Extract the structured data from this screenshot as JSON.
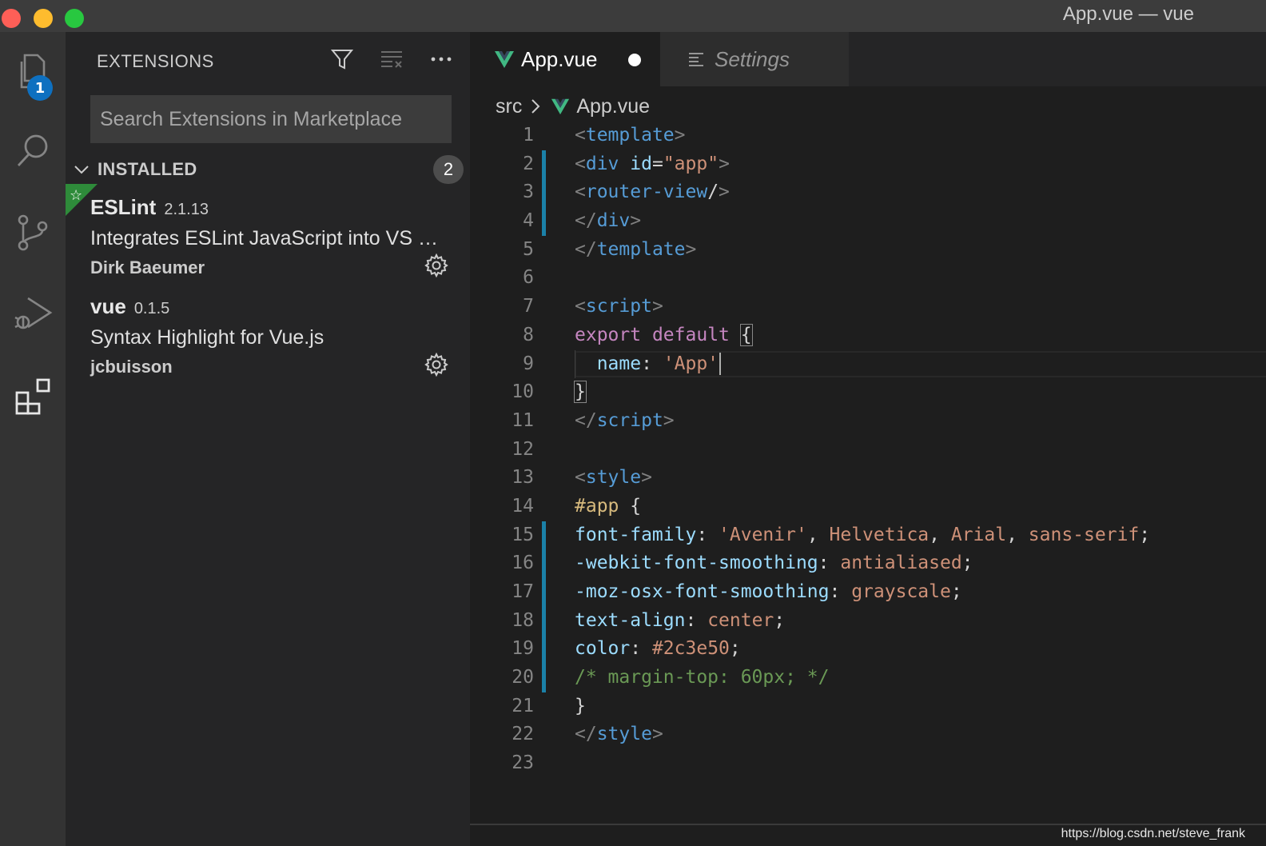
{
  "window": {
    "title": "App.vue — vue"
  },
  "activity_bar": {
    "items": [
      {
        "name": "explorer",
        "icon": "files-icon",
        "badge": "1"
      },
      {
        "name": "search",
        "icon": "search-icon"
      },
      {
        "name": "source-control",
        "icon": "source-control-icon"
      },
      {
        "name": "run-debug",
        "icon": "run-debug-icon"
      },
      {
        "name": "extensions",
        "icon": "extensions-icon",
        "active": true
      }
    ]
  },
  "sidebar": {
    "title": "EXTENSIONS",
    "actions": [
      "filter-icon",
      "clear-icon",
      "more-icon"
    ],
    "search": {
      "placeholder": "Search Extensions in Marketplace",
      "value": ""
    },
    "installed": {
      "label": "INSTALLED",
      "count": "2"
    },
    "extensions": [
      {
        "name": "ESLint",
        "version": "2.1.13",
        "description": "Integrates ESLint JavaScript into VS Code.",
        "author": "Dirk Baeumer",
        "recommended": true
      },
      {
        "name": "vue",
        "version": "0.1.5",
        "description": "Syntax Highlight for Vue.js",
        "author": "jcbuisson",
        "recommended": false
      }
    ]
  },
  "editor": {
    "tabs": [
      {
        "label": "App.vue",
        "active": true,
        "dirty": true
      },
      {
        "label": "Settings",
        "active": false
      }
    ],
    "breadcrumb": [
      "src",
      "App.vue"
    ],
    "lines": [
      [
        [
          "punc",
          "<"
        ],
        [
          "tag",
          "template"
        ],
        [
          "punc",
          ">"
        ]
      ],
      [
        [
          "punc",
          "<"
        ],
        [
          "tag",
          "div"
        ],
        [
          "txt",
          " "
        ],
        [
          "attr",
          "id"
        ],
        [
          "txt",
          "="
        ],
        [
          "str",
          "\"app\""
        ],
        [
          "punc",
          ">"
        ]
      ],
      [
        [
          "punc",
          "<"
        ],
        [
          "tag",
          "router-view"
        ],
        [
          "txt",
          "/"
        ],
        [
          "punc",
          ">"
        ]
      ],
      [
        [
          "punc",
          "</"
        ],
        [
          "tag",
          "div"
        ],
        [
          "punc",
          ">"
        ]
      ],
      [
        [
          "punc",
          "</"
        ],
        [
          "tag",
          "template"
        ],
        [
          "punc",
          ">"
        ]
      ],
      [],
      [
        [
          "punc",
          "<"
        ],
        [
          "tag",
          "script"
        ],
        [
          "punc",
          ">"
        ]
      ],
      [
        [
          "kw",
          "export"
        ],
        [
          "txt",
          " "
        ],
        [
          "kw",
          "default"
        ],
        [
          "txt",
          " "
        ],
        [
          "bracket",
          "{"
        ]
      ],
      [
        [
          "txt",
          "  "
        ],
        [
          "prop",
          "name"
        ],
        [
          "txt",
          ": "
        ],
        [
          "str",
          "'App'"
        ]
      ],
      [
        [
          "bracket",
          "}"
        ]
      ],
      [
        [
          "punc",
          "</"
        ],
        [
          "tag",
          "script"
        ],
        [
          "punc",
          ">"
        ]
      ],
      [],
      [
        [
          "punc",
          "<"
        ],
        [
          "tag",
          "style"
        ],
        [
          "punc",
          ">"
        ]
      ],
      [
        [
          "sel",
          "#app"
        ],
        [
          "txt",
          " {"
        ]
      ],
      [
        [
          "prop",
          "font-family"
        ],
        [
          "txt",
          ": "
        ],
        [
          "str",
          "'Avenir'"
        ],
        [
          "txt",
          ", "
        ],
        [
          "str",
          "Helvetica"
        ],
        [
          "txt",
          ", "
        ],
        [
          "str",
          "Arial"
        ],
        [
          "txt",
          ", "
        ],
        [
          "str",
          "sans-serif"
        ],
        [
          "txt",
          ";"
        ]
      ],
      [
        [
          "prop",
          "-webkit-font-smoothing"
        ],
        [
          "txt",
          ": "
        ],
        [
          "str",
          "antialiased"
        ],
        [
          "txt",
          ";"
        ]
      ],
      [
        [
          "prop",
          "-moz-osx-font-smoothing"
        ],
        [
          "txt",
          ": "
        ],
        [
          "str",
          "grayscale"
        ],
        [
          "txt",
          ";"
        ]
      ],
      [
        [
          "prop",
          "text-align"
        ],
        [
          "txt",
          ": "
        ],
        [
          "str",
          "center"
        ],
        [
          "txt",
          ";"
        ]
      ],
      [
        [
          "prop",
          "color"
        ],
        [
          "txt",
          ": "
        ],
        [
          "str",
          "#2c3e50"
        ],
        [
          "txt",
          ";"
        ]
      ],
      [
        [
          "com",
          "/* margin-top: 60px; */"
        ]
      ],
      [
        [
          "txt",
          "}"
        ]
      ],
      [
        [
          "punc",
          "</"
        ],
        [
          "tag",
          "style"
        ],
        [
          "punc",
          ">"
        ]
      ],
      []
    ],
    "modified_lines": [
      2,
      3,
      4,
      15,
      16,
      17,
      18,
      19,
      20
    ],
    "current_line": 9
  },
  "watermark": "https://blog.csdn.net/steve_frank",
  "colors": {
    "accent": "#0e70c0",
    "vue_green": "#41b883",
    "gutter_modified": "#1b81a8"
  }
}
